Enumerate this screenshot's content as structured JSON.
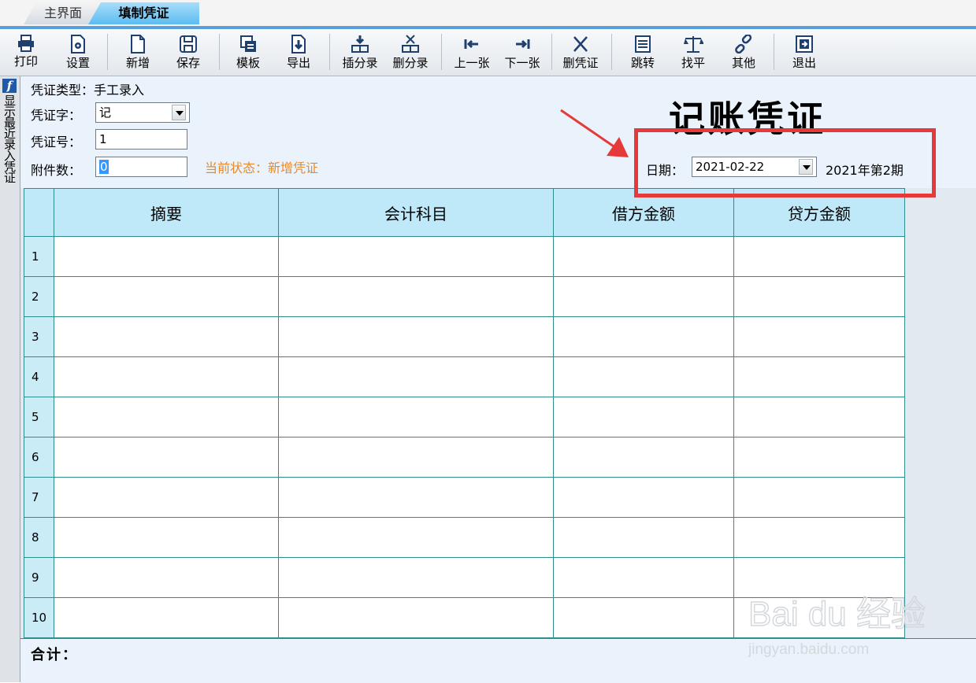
{
  "tabs": {
    "main": "主界面",
    "voucher": "填制凭证"
  },
  "toolbar": {
    "print": "打印",
    "settings": "设置",
    "new": "新增",
    "save": "保存",
    "template": "模板",
    "export": "导出",
    "insert_entry": "插分录",
    "delete_entry": "删分录",
    "prev": "上一张",
    "next": "下一张",
    "delete_voucher": "删凭证",
    "jump": "跳转",
    "balance": "找平",
    "other": "其他",
    "exit": "退出"
  },
  "sidebar": {
    "label": "显示最近录入凭证"
  },
  "header": {
    "voucher_type_label": "凭证类型：",
    "voucher_type_value": "手工录入",
    "voucher_word_label": "凭证字：",
    "voucher_word_value": "记",
    "voucher_no_label": "凭证号：",
    "voucher_no_value": "1",
    "attachments_label": "附件数：",
    "attachments_value": "0",
    "status_label": "当前状态：新增凭证",
    "title": "记账凭证",
    "date_label": "日期：",
    "date_value": "2021-02-22",
    "period": "2021年第2期"
  },
  "grid": {
    "columns": [
      "摘要",
      "会计科目",
      "借方金额",
      "贷方金额"
    ],
    "rows": [
      "1",
      "2",
      "3",
      "4",
      "5",
      "6",
      "7",
      "8",
      "9",
      "10"
    ]
  },
  "footer": {
    "total_label": "合计："
  },
  "watermark": {
    "brand": "Bai du 经验",
    "url": "jingyan.baidu.com"
  },
  "colors": {
    "tab_active": "#5cbcf0",
    "header_bg": "#bfe8f8",
    "grid_line": "#2f8d8d",
    "status": "#e8892b",
    "highlight": "#e63a3a"
  }
}
